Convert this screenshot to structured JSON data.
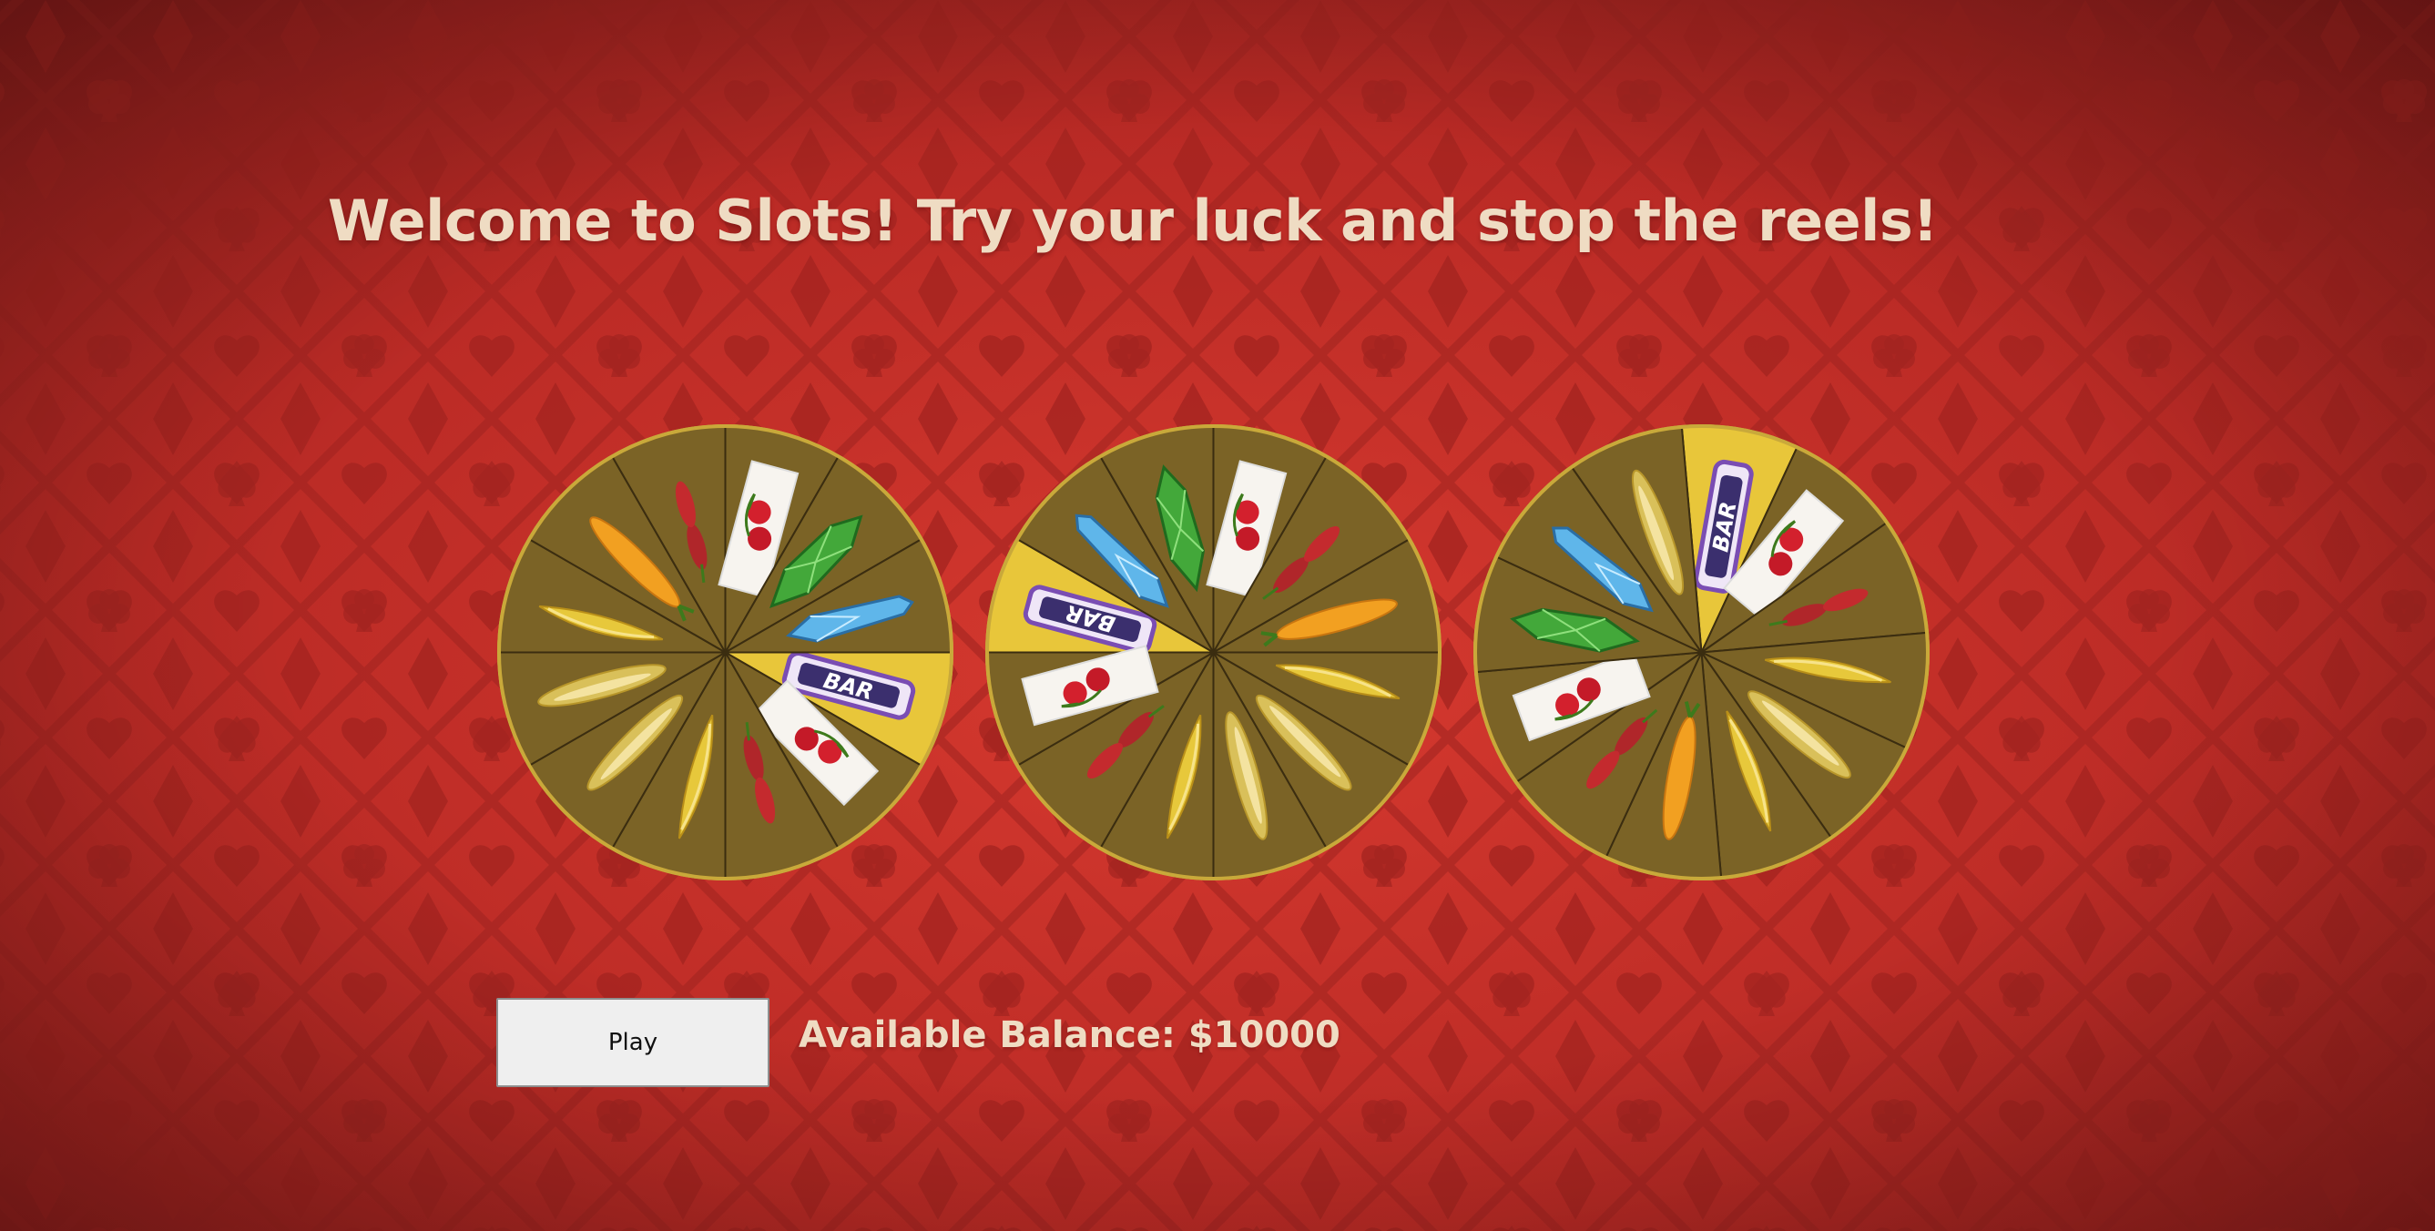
{
  "welcome_message": "Welcome to Slots! Try your luck and stop the reels!",
  "play_button_label": "Play",
  "balance_text": "Available Balance: $10000",
  "colors": {
    "background": "#c8302b",
    "background_pattern": "#a82420",
    "wheel_rim": "#c9a93a",
    "wheel_sector": "#7b6326",
    "wheel_sector_highlight": "#e8c63a",
    "wheel_divider": "#3b2d10",
    "text_light": "#efdcc3"
  },
  "reels": [
    {
      "name": "reel-1",
      "symbols": [
        "bar",
        "cherry",
        "cherries",
        "banana",
        "lemon",
        "lemon",
        "banana",
        "orange",
        "cherries",
        "cherry",
        "emerald",
        "diamond"
      ],
      "highlighted_symbol": "bar"
    },
    {
      "name": "reel-2",
      "symbols": [
        "bar",
        "diamond",
        "emerald",
        "cherry",
        "cherries",
        "orange",
        "banana",
        "lemon",
        "lemon",
        "banana",
        "cherries",
        "cherry"
      ],
      "highlighted_symbol": "bar"
    },
    {
      "name": "reel-3",
      "symbols": [
        "bar",
        "cherry",
        "cherries",
        "banana",
        "lemon",
        "banana",
        "orange",
        "cherries",
        "cherry",
        "emerald",
        "diamond",
        "lemon"
      ],
      "highlighted_symbol": "bar"
    }
  ]
}
